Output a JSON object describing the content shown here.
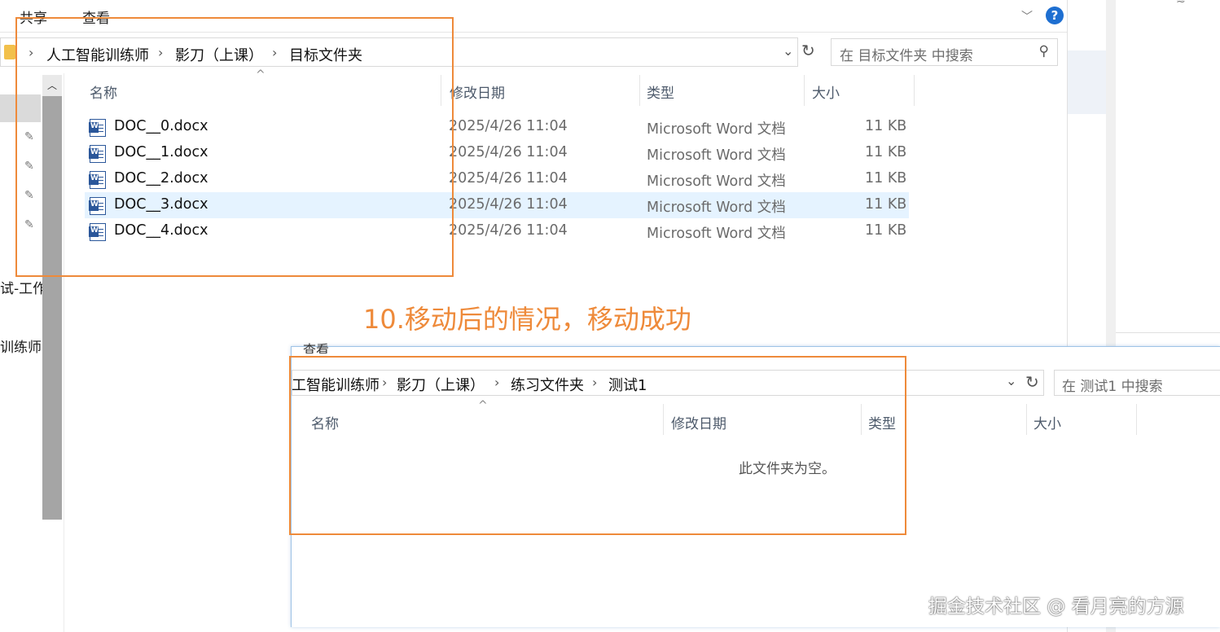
{
  "window1": {
    "ribbon": {
      "share": "共享",
      "view": "查看"
    },
    "breadcrumb": [
      "人工智能训练师",
      "影刀（上课）",
      "目标文件夹"
    ],
    "search_placeholder": "在 目标文件夹 中搜索",
    "columns": {
      "name": "名称",
      "date": "修改日期",
      "type": "类型",
      "size": "大小"
    },
    "files": [
      {
        "name": "DOC__0.docx",
        "date": "2025/4/26 11:04",
        "type": "Microsoft Word 文档",
        "size": "11 KB"
      },
      {
        "name": "DOC__1.docx",
        "date": "2025/4/26 11:04",
        "type": "Microsoft Word 文档",
        "size": "11 KB"
      },
      {
        "name": "DOC__2.docx",
        "date": "2025/4/26 11:04",
        "type": "Microsoft Word 文档",
        "size": "11 KB"
      },
      {
        "name": "DOC__3.docx",
        "date": "2025/4/26 11:04",
        "type": "Microsoft Word 文档",
        "size": "11 KB",
        "selected": true
      },
      {
        "name": "DOC__4.docx",
        "date": "2025/4/26 11:04",
        "type": "Microsoft Word 文档",
        "size": "11 KB"
      }
    ],
    "nav_fragments": [
      "试-工作",
      "训练师"
    ]
  },
  "annotation": "10.移动后的情况，移动成功",
  "window2": {
    "ribbon_view": "查看",
    "breadcrumb": [
      "工智能训练师",
      "影刀（上课）",
      "练习文件夹",
      "测试1"
    ],
    "search_placeholder": "在 测试1 中搜索",
    "columns": {
      "name": "名称",
      "date": "修改日期",
      "type": "类型",
      "size": "大小"
    },
    "empty_message": "此文件夹为空。"
  },
  "watermark": "掘金技术社区 @ 看月亮的方源",
  "colors": {
    "highlight_box": "#ee8a3a",
    "selection": "#e5f3ff",
    "help": "#1e6fd1"
  }
}
